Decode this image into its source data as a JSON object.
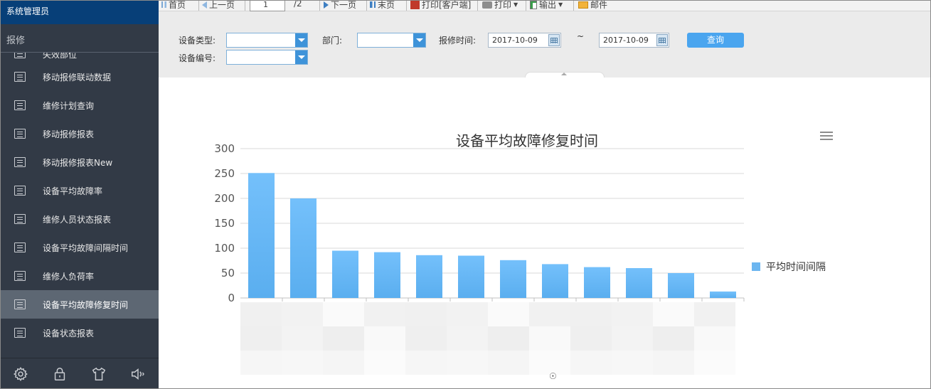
{
  "sidebar": {
    "user": "系统管理员",
    "section": "报修",
    "items": [
      {
        "label": "失效部位"
      },
      {
        "label": "移动报修联动数据"
      },
      {
        "label": "维修计划查询"
      },
      {
        "label": "移动报修报表"
      },
      {
        "label": "移动报修报表New"
      },
      {
        "label": "设备平均故障率"
      },
      {
        "label": "维修人员状态报表"
      },
      {
        "label": "设备平均故障间隔时间"
      },
      {
        "label": "维修人负荷率"
      },
      {
        "label": "设备平均故障修复时间"
      },
      {
        "label": "设备状态报表"
      }
    ],
    "active_index": 9,
    "footer_icons": [
      "gear-icon",
      "lock-icon",
      "shirt-icon",
      "speaker-icon"
    ]
  },
  "toolbar": {
    "first": "首页",
    "prev": "上一页",
    "page_value": "1",
    "page_total": "/2",
    "next": "下一页",
    "last": "末页",
    "print_client": "打印[客户端]",
    "print": "打印",
    "export": "输出",
    "mail": "邮件"
  },
  "filters": {
    "device_type_label": "设备类型:",
    "department_label": "部门:",
    "repair_time_label": "报修时间:",
    "device_code_label": "设备编号:",
    "date_from": "2017-10-09",
    "date_to": "2017-10-09",
    "tilde": "~",
    "query_label": "查询"
  },
  "chart_data": {
    "type": "bar",
    "title": "设备平均故障修复时间",
    "categories": [
      "",
      "",
      "",
      "",
      "",
      "",
      "",
      "",
      "",
      "",
      "",
      ""
    ],
    "series": [
      {
        "name": "平均时间间隔",
        "values": [
          251,
          200,
          95,
          92,
          86,
          85,
          76,
          68,
          62,
          60,
          50,
          13
        ]
      }
    ],
    "ylim": [
      0,
      300
    ],
    "yticks": [
      "0",
      "50",
      "100",
      "150",
      "200",
      "250",
      "300"
    ],
    "grid": true,
    "legend_position": "right",
    "color": "#6cb6f0"
  }
}
